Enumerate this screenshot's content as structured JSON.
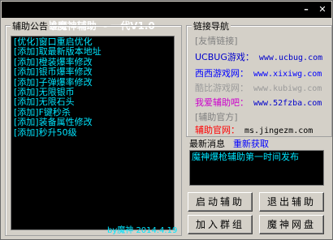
{
  "window": {
    "title": "爆枪英雄魔神辅助  - 一代V1.0",
    "minimize": "–",
    "close": "✕"
  },
  "notice": {
    "title": "辅助公告",
    "items": [
      "[优化]窗口重启优化",
      "[添加]取最新版本地址",
      "[添加]橙装爆率修改",
      "[添加]银币爆率修改",
      "[添加]子弹爆率修改",
      "[添加]无限银币",
      "[添加]无限石头",
      "[添加]F键秒杀",
      "[添加]装备属性修改",
      "[添加]秒升50级"
    ],
    "footer": "by魔神  2014.4.19"
  },
  "links": {
    "title": "链接导航",
    "section1": "[友情链接]",
    "rows": [
      {
        "label": "UCBUG游戏：",
        "url": "www.ucbug.com",
        "label_color": "#0000cc",
        "url_color": "#0000cc"
      },
      {
        "label": "西西游戏网：",
        "url": "www.xixiwg.com",
        "label_color": "#0000ff",
        "url_color": "#0000ff"
      },
      {
        "label": "酷比游戏网：",
        "url": "www.kubiwg.com",
        "label_color": "#9a9a9a",
        "url_color": "#9a9a9a"
      },
      {
        "label": "我爱辅助吧：",
        "url": "www.52fzba.com",
        "label_color": "#cc00cc",
        "url_color": "#0000cc"
      }
    ],
    "section2": "[辅助官方]",
    "official": {
      "label": "辅助官网：",
      "url": "ms.jingezm.com",
      "label_color": "#ff0000",
      "url_color": "#000000"
    }
  },
  "latest": {
    "title": "最新消息",
    "refresh": "重新获取",
    "message": "魔神爆枪辅助第一时间发布"
  },
  "buttons": {
    "start": "启动辅助",
    "exit": "退出辅助",
    "join_group": "加入群组",
    "netdisk": "魔神网盘"
  }
}
